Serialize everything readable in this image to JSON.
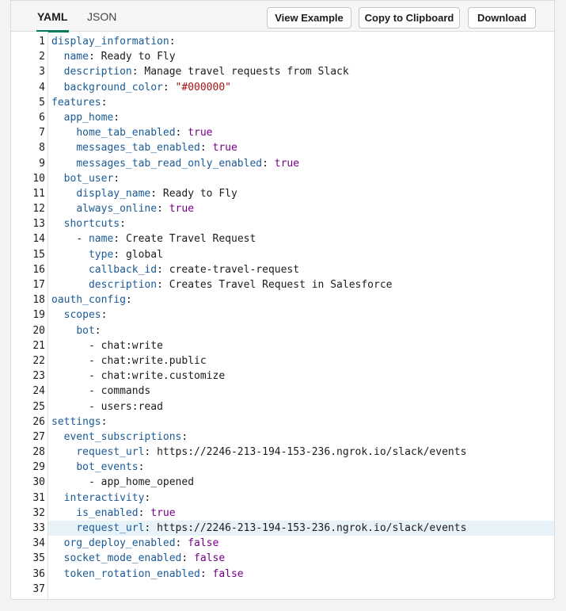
{
  "tabs": [
    {
      "label": "YAML",
      "active": true
    },
    {
      "label": "JSON",
      "active": false
    }
  ],
  "toolbar": {
    "view_example_label": "View Example",
    "copy_label": "Copy to Clipboard",
    "download_label": "Download"
  },
  "editor": {
    "highlighted_line": 33,
    "lines": [
      {
        "n": "1",
        "indent": "",
        "dash": "",
        "key": "display_information",
        "value": "",
        "vtype": ""
      },
      {
        "n": "2",
        "indent": "  ",
        "dash": "",
        "key": "name",
        "value": "Ready to Fly",
        "vtype": "v"
      },
      {
        "n": "3",
        "indent": "  ",
        "dash": "",
        "key": "description",
        "value": "Manage travel requests from Slack",
        "vtype": "v"
      },
      {
        "n": "4",
        "indent": "  ",
        "dash": "",
        "key": "background_color",
        "value": "\"#000000\"",
        "vtype": "s"
      },
      {
        "n": "5",
        "indent": "",
        "dash": "",
        "key": "features",
        "value": "",
        "vtype": ""
      },
      {
        "n": "6",
        "indent": "  ",
        "dash": "",
        "key": "app_home",
        "value": "",
        "vtype": ""
      },
      {
        "n": "7",
        "indent": "    ",
        "dash": "",
        "key": "home_tab_enabled",
        "value": "true",
        "vtype": "b"
      },
      {
        "n": "8",
        "indent": "    ",
        "dash": "",
        "key": "messages_tab_enabled",
        "value": "true",
        "vtype": "b"
      },
      {
        "n": "9",
        "indent": "    ",
        "dash": "",
        "key": "messages_tab_read_only_enabled",
        "value": "true",
        "vtype": "b"
      },
      {
        "n": "10",
        "indent": "  ",
        "dash": "",
        "key": "bot_user",
        "value": "",
        "vtype": ""
      },
      {
        "n": "11",
        "indent": "    ",
        "dash": "",
        "key": "display_name",
        "value": "Ready to Fly",
        "vtype": "v"
      },
      {
        "n": "12",
        "indent": "    ",
        "dash": "",
        "key": "always_online",
        "value": "true",
        "vtype": "b"
      },
      {
        "n": "13",
        "indent": "  ",
        "dash": "",
        "key": "shortcuts",
        "value": "",
        "vtype": ""
      },
      {
        "n": "14",
        "indent": "    ",
        "dash": "- ",
        "key": "name",
        "value": "Create Travel Request",
        "vtype": "v"
      },
      {
        "n": "15",
        "indent": "      ",
        "dash": "",
        "key": "type",
        "value": "global",
        "vtype": "v"
      },
      {
        "n": "16",
        "indent": "      ",
        "dash": "",
        "key": "callback_id",
        "value": "create-travel-request",
        "vtype": "v"
      },
      {
        "n": "17",
        "indent": "      ",
        "dash": "",
        "key": "description",
        "value": "Creates Travel Request in Salesforce",
        "vtype": "v"
      },
      {
        "n": "18",
        "indent": "",
        "dash": "",
        "key": "oauth_config",
        "value": "",
        "vtype": ""
      },
      {
        "n": "19",
        "indent": "  ",
        "dash": "",
        "key": "scopes",
        "value": "",
        "vtype": ""
      },
      {
        "n": "20",
        "indent": "    ",
        "dash": "",
        "key": "bot",
        "value": "",
        "vtype": ""
      },
      {
        "n": "21",
        "indent": "      ",
        "dash": "- ",
        "key": "",
        "value": "chat:write",
        "vtype": "v"
      },
      {
        "n": "22",
        "indent": "      ",
        "dash": "- ",
        "key": "",
        "value": "chat:write.public",
        "vtype": "v"
      },
      {
        "n": "23",
        "indent": "      ",
        "dash": "- ",
        "key": "",
        "value": "chat:write.customize",
        "vtype": "v"
      },
      {
        "n": "24",
        "indent": "      ",
        "dash": "- ",
        "key": "",
        "value": "commands",
        "vtype": "v"
      },
      {
        "n": "25",
        "indent": "      ",
        "dash": "- ",
        "key": "",
        "value": "users:read",
        "vtype": "v"
      },
      {
        "n": "26",
        "indent": "",
        "dash": "",
        "key": "settings",
        "value": "",
        "vtype": ""
      },
      {
        "n": "27",
        "indent": "  ",
        "dash": "",
        "key": "event_subscriptions",
        "value": "",
        "vtype": ""
      },
      {
        "n": "28",
        "indent": "    ",
        "dash": "",
        "key": "request_url",
        "value": "https://2246-213-194-153-236.ngrok.io/slack/events",
        "vtype": "v"
      },
      {
        "n": "29",
        "indent": "    ",
        "dash": "",
        "key": "bot_events",
        "value": "",
        "vtype": ""
      },
      {
        "n": "30",
        "indent": "      ",
        "dash": "- ",
        "key": "",
        "value": "app_home_opened",
        "vtype": "v"
      },
      {
        "n": "31",
        "indent": "  ",
        "dash": "",
        "key": "interactivity",
        "value": "",
        "vtype": ""
      },
      {
        "n": "32",
        "indent": "    ",
        "dash": "",
        "key": "is_enabled",
        "value": "true",
        "vtype": "b"
      },
      {
        "n": "33",
        "indent": "    ",
        "dash": "",
        "key": "request_url",
        "value": "https://2246-213-194-153-236.ngrok.io/slack/events",
        "vtype": "v"
      },
      {
        "n": "34",
        "indent": "  ",
        "dash": "",
        "key": "org_deploy_enabled",
        "value": "false",
        "vtype": "b"
      },
      {
        "n": "35",
        "indent": "  ",
        "dash": "",
        "key": "socket_mode_enabled",
        "value": "false",
        "vtype": "b"
      },
      {
        "n": "36",
        "indent": "  ",
        "dash": "",
        "key": "token_rotation_enabled",
        "value": "false",
        "vtype": "b"
      },
      {
        "n": "37",
        "indent": "",
        "dash": "",
        "key": "",
        "value": "",
        "vtype": ""
      }
    ]
  }
}
